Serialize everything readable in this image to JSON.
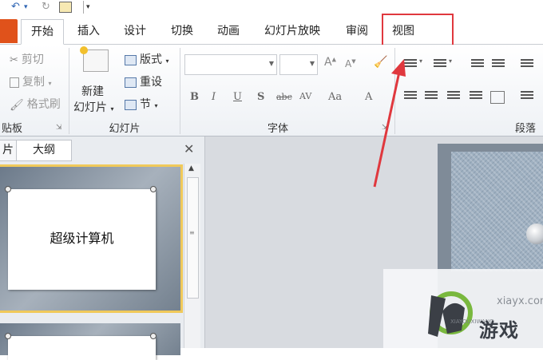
{
  "colors": {
    "highlight": "#e0383e",
    "file_tab": "#e0521b",
    "selected_thumb": "#f0c95a"
  },
  "qat": {
    "undo_icon": "undo-icon",
    "redo_icon": "redo-icon",
    "save_icon": "save-icon"
  },
  "tabs": [
    {
      "label": "开始",
      "active": true
    },
    {
      "label": "插入"
    },
    {
      "label": "设计"
    },
    {
      "label": "切换"
    },
    {
      "label": "动画"
    },
    {
      "label": "幻灯片放映"
    },
    {
      "label": "审阅"
    },
    {
      "label": "视图"
    }
  ],
  "ribbon": {
    "clipboard": {
      "cut": "剪切",
      "copy": "复制",
      "format_painter": "格式刷",
      "group_label": "贴板"
    },
    "slides": {
      "new_slide_line1": "新建",
      "new_slide_line2": "幻灯片",
      "layout": "版式",
      "reset": "重设",
      "section": "节",
      "group_label": "幻灯片"
    },
    "font": {
      "group_label": "字体",
      "buttons": [
        "B",
        "I",
        "U",
        "S",
        "abc",
        "AV",
        "Aa",
        "A"
      ]
    },
    "paragraph": {
      "group_label": "段落"
    }
  },
  "panel": {
    "tabs": [
      "片",
      "大纲"
    ],
    "close_icon": "close-icon",
    "slides": [
      {
        "title": "超级计算机"
      },
      {
        "title": ""
      }
    ]
  },
  "watermark": {
    "url": "xiayx.com",
    "text": "游戏",
    "sub": "XIAYOUXIWANG"
  }
}
